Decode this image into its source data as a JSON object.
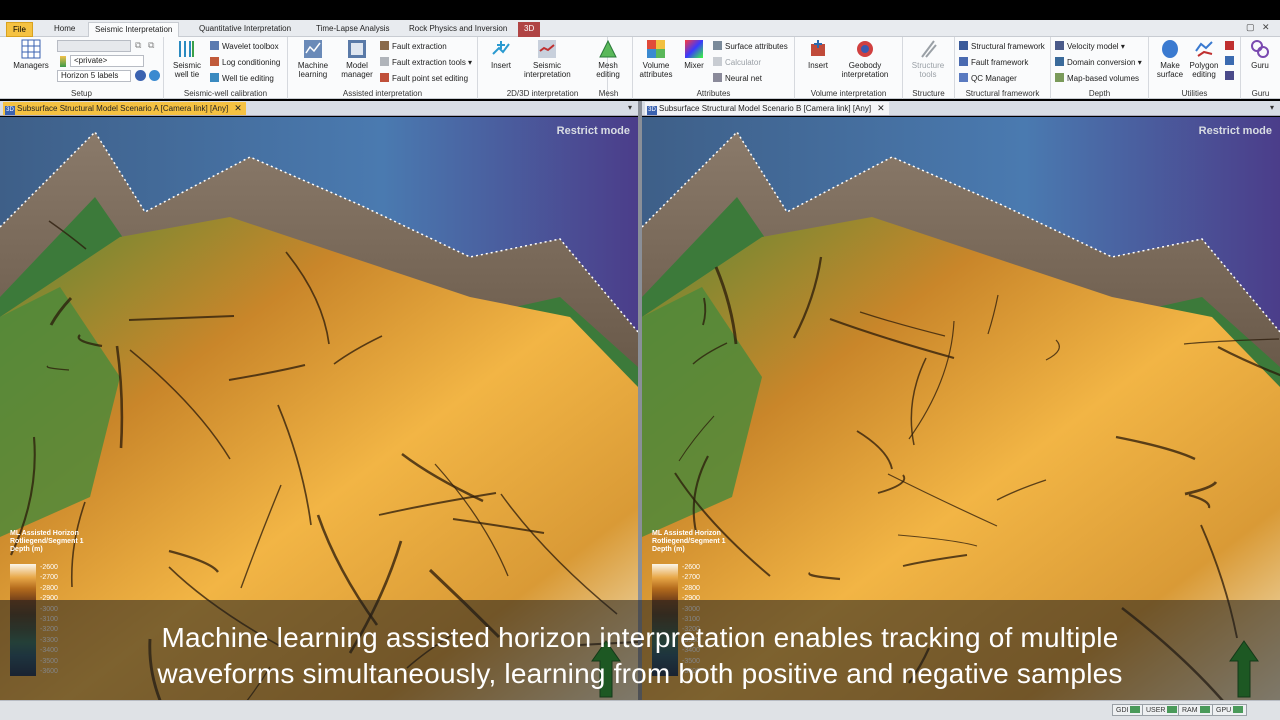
{
  "tabs": [
    {
      "label": "File",
      "kind": "file"
    },
    {
      "label": "Home",
      "kind": "normal"
    },
    {
      "label": "Seismic Interpretation",
      "kind": "active"
    },
    {
      "label": "Quantitative Interpretation",
      "kind": "normal"
    },
    {
      "label": "Time-Lapse Analysis",
      "kind": "normal"
    },
    {
      "label": "Rock Physics and Inversion",
      "kind": "normal"
    },
    {
      "label": "3D",
      "kind": "tab3d"
    }
  ],
  "ribbon": {
    "setup": {
      "label": "Setup",
      "managers": "Managers",
      "private_combo": "<private>",
      "labels_combo": "Horizon 5 labels"
    },
    "seismic_well": {
      "label": "Seismic-well calibration",
      "well_tie_big": "Seismic well tie",
      "wavelet_toolbox": "Wavelet toolbox",
      "log_conditioning": "Log conditioning",
      "well_tie_editing": "Well tie editing"
    },
    "assisted": {
      "label": "Assisted interpretation",
      "machine_learning": "Machine learning",
      "model_manager": "Model manager",
      "fault_extraction": "Fault extraction",
      "fault_extraction_tools": "Fault extraction tools",
      "fault_point_set_editing": "Fault point set editing"
    },
    "interp2d3d": {
      "label": "2D/3D interpretation",
      "insert": "Insert",
      "seismic_interpretation": "Seismic interpretation"
    },
    "mesh": {
      "label": "Mesh",
      "mesh_editing": "Mesh editing"
    },
    "attributes": {
      "label": "Attributes",
      "volume_attributes": "Volume attributes",
      "mixer": "Mixer",
      "surface_attributes": "Surface attributes",
      "calculator": "Calculator",
      "neural_net": "Neural net"
    },
    "volume_interp": {
      "label": "Volume interpretation",
      "insert": "Insert",
      "geobody_interpretation": "Geobody interpretation"
    },
    "structure": {
      "label": "Structure",
      "structure_tools": "Structure tools"
    },
    "structural_framework": {
      "label": "Structural framework",
      "structural_framework": "Structural framework",
      "fault_framework": "Fault framework",
      "qc_manager": "QC Manager"
    },
    "depth": {
      "label": "Depth",
      "velocity_model": "Velocity model",
      "domain_conversion": "Domain conversion",
      "map_based_volumes": "Map-based volumes"
    },
    "utilities": {
      "label": "Utilities",
      "make_surface": "Make surface",
      "polygon_editing": "Polygon editing"
    },
    "guru": {
      "label": "Guru",
      "guru": "Guru"
    }
  },
  "viewports": {
    "left": {
      "title": "Subsurface Structural Model Scenario A [Camera link]  [Any]",
      "restrict": "Restrict mode"
    },
    "right": {
      "title": "Subsurface Structural Model Scenario B [Camera link]  [Any]",
      "restrict": "Restrict mode"
    }
  },
  "legend": {
    "title_1": "ML Assisted Horizon",
    "title_2": "Rotliegend/Segment 1",
    "title_3": "Depth (m)",
    "ticks": [
      "-2600",
      "-2700",
      "-2800",
      "-2900",
      "-3000",
      "-3100",
      "-3200",
      "-3300",
      "-3400",
      "-3500",
      "-3600"
    ]
  },
  "subtitle": {
    "line1": "Machine learning assisted horizon interpretation enables tracking of multiple",
    "line2": "waveforms simultaneously, learning from both positive and negative samples"
  },
  "statusbar": {
    "gdi": "GDI",
    "user": "USER",
    "ram": "RAM",
    "gpu": "GPU"
  },
  "colors": {
    "file_tab": "#f5c242",
    "tab_3d": "#b04444",
    "horizon_high": "#f2b545",
    "horizon_low": "#5f8a35",
    "seismic_blue": "#4a7ab0"
  }
}
